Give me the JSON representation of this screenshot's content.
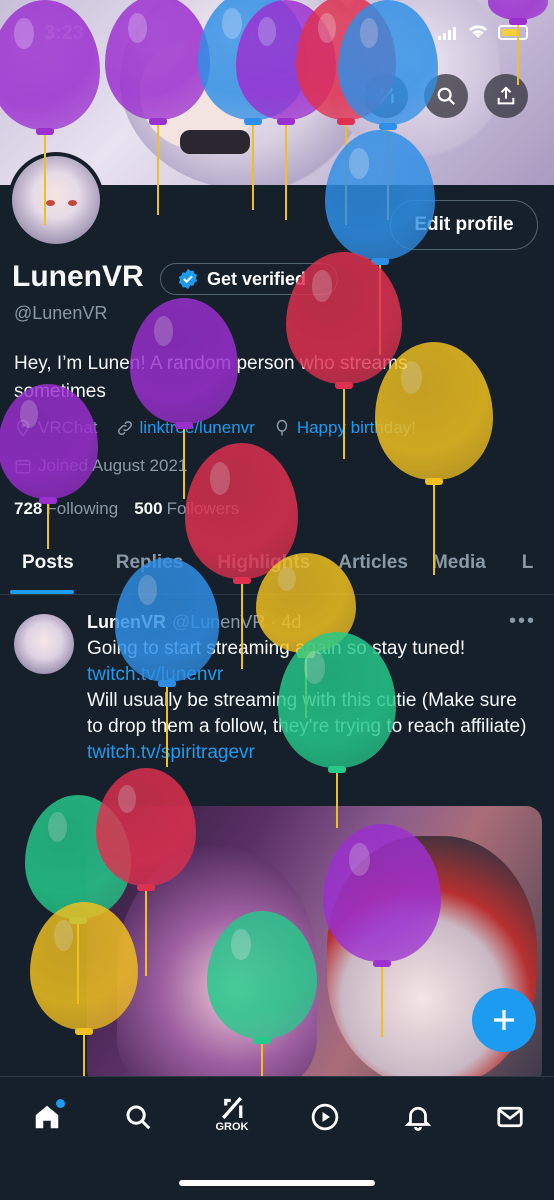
{
  "status_bar": {
    "time": "3:23"
  },
  "profile": {
    "name": "LunenVR",
    "get_verified_label": "Get verified",
    "handle": "@LunenVR",
    "edit_profile_label": "Edit profile",
    "bio": "Hey, I’m Lunen! A random person who streams sometimes",
    "location": "VRChat",
    "website": "linktree/lunenvr",
    "birthday": "Happy birthday!",
    "joined": "Joined August 2021",
    "following_count": "728",
    "following_label": "Following",
    "followers_count": "500",
    "followers_label": "Followers"
  },
  "tabs": [
    {
      "label": "Posts",
      "active": true
    },
    {
      "label": "Replies"
    },
    {
      "label": "Highlights"
    },
    {
      "label": "Articles"
    },
    {
      "label": "Media"
    },
    {
      "label": "L"
    }
  ],
  "post": {
    "name": "LunenVR",
    "handle_time": "@LunenVR · 4d",
    "line1": "Going to start streaming again so stay tuned!",
    "link1": "twitch.tv/lunenvr",
    "line2": "Will usually be streaming with this cutie (Make sure to drop them a follow, they're trying to reach affiliate)",
    "link2": "twitch.tv/spiritragevr"
  },
  "bottom_nav": {
    "items": [
      "home-icon",
      "search-icon",
      "grok-icon",
      "video-icon",
      "notifications-icon",
      "messages-icon"
    ],
    "grok_label": "GROK"
  },
  "colors": {
    "background": "#15202b",
    "accent": "#1d9bf0",
    "muted": "#8b98a5",
    "balloon_purple": "#9b2fd0",
    "balloon_blue": "#2f8fe6",
    "balloon_red": "#e0304f",
    "balloon_yellow": "#f0c020",
    "balloon_green": "#25c98a"
  }
}
